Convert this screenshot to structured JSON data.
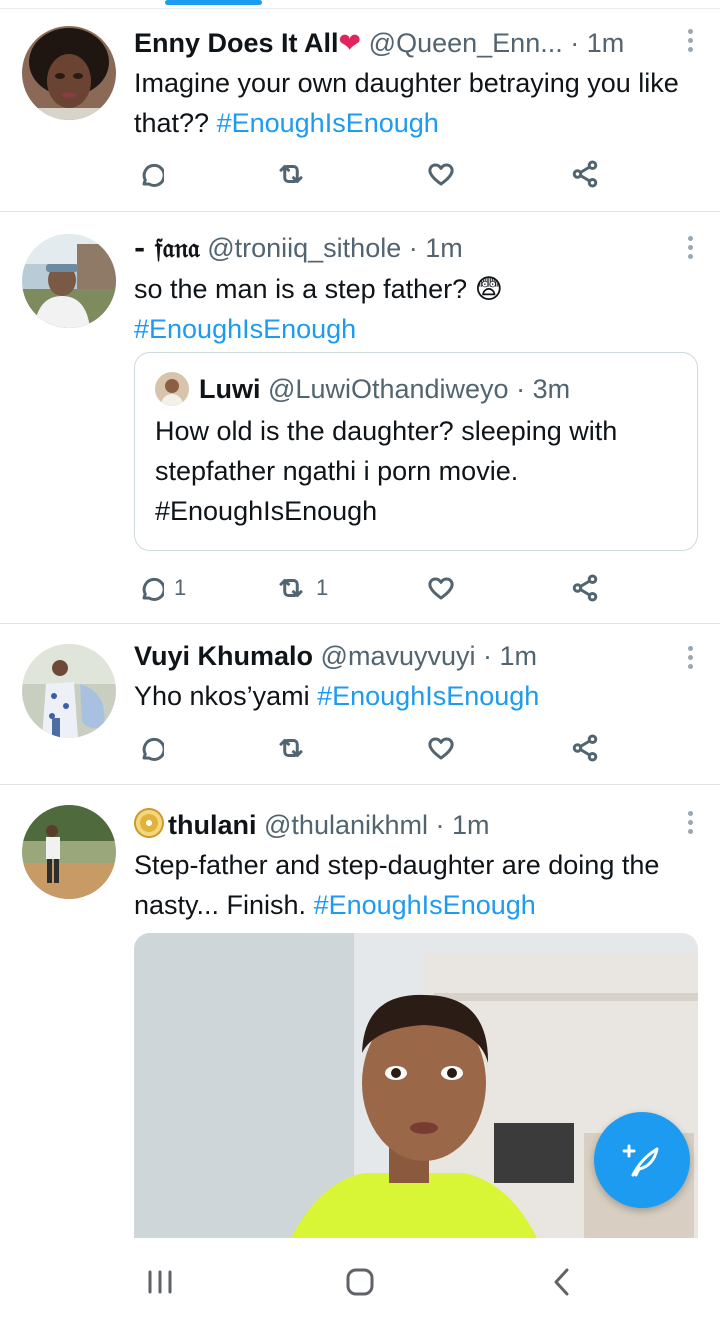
{
  "colors": {
    "accent": "#1d9bf0",
    "text": "#0f1419",
    "secondary": "#536471"
  },
  "tweets": [
    {
      "name": "Enny Does It All",
      "name_emoji": "heart",
      "handle": "@Queen_Enn...",
      "time": "· 1m",
      "text": "Imagine your own daughter betraying you like that??",
      "hashtag": "#EnoughIsEnough",
      "replies": "",
      "retweets": "",
      "likes": ""
    },
    {
      "name": "- 𝔣𝔞𝔫𝔞",
      "handle": "@troniiq_sithole",
      "time": "· 1m",
      "text": "so the man is a step father?",
      "text_emoji": "😨",
      "hashtag": "#EnoughIsEnough",
      "quote": {
        "name": "Luwi",
        "handle": "@LuwiOthandiweyo",
        "time": "· 3m",
        "text": "How old is the daughter? sleeping with stepfather ngathi i porn movie. #EnoughIsEnough"
      },
      "replies": "1",
      "retweets": "1",
      "likes": ""
    },
    {
      "name": "Vuyi Khumalo",
      "handle": "@mavuyvuyi",
      "time": "· 1m",
      "text": "Yho nkos’yami",
      "hashtag": "#EnoughIsEnough",
      "replies": "",
      "retweets": "",
      "likes": ""
    },
    {
      "name": "thulani",
      "name_prefix_icon": "cd-disc",
      "handle": "@thulanikhml",
      "time": "· 1m",
      "text": "Step-father and step-daughter are doing the nasty... Finish.",
      "hashtag": "#EnoughIsEnough",
      "media": "photo"
    }
  ],
  "fab": {
    "icon": "compose-feather-icon"
  },
  "nav": {
    "icons": [
      "recent-apps-icon",
      "home-icon",
      "back-icon"
    ]
  }
}
